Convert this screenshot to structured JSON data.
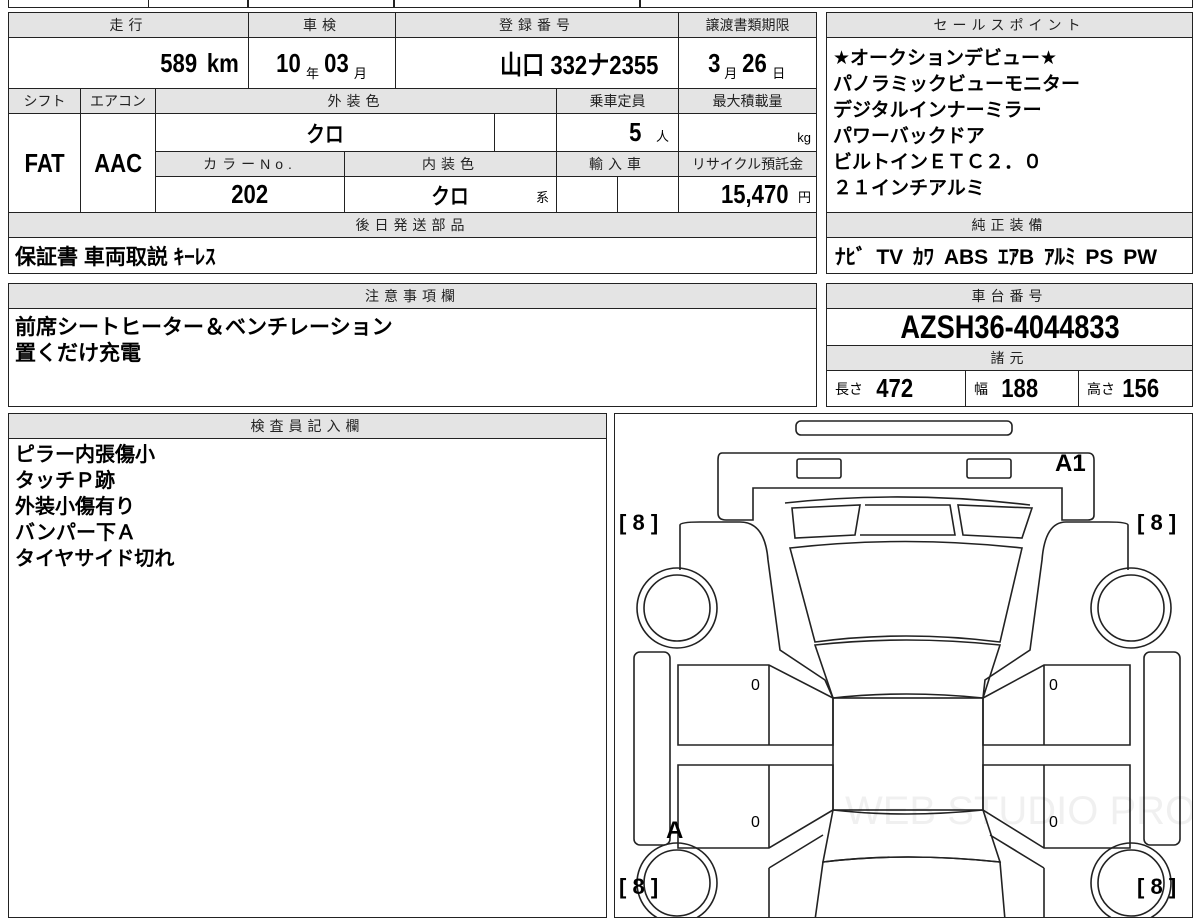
{
  "main": {
    "mileage": {
      "label": "走行",
      "value": "589",
      "unit": "km"
    },
    "inspection": {
      "label": "車検",
      "year": "10",
      "year_unit": "年",
      "month": "03",
      "month_unit": "月"
    },
    "registration": {
      "label": "登録番号",
      "value": "山口 332ナ2355"
    },
    "transfer_deadline": {
      "label": "譲渡書類期限",
      "month": "3",
      "month_unit": "月",
      "day": "26",
      "day_unit": "日"
    },
    "shift": {
      "label": "シフト",
      "value": "FAT"
    },
    "aircon": {
      "label": "エアコン",
      "value": "AAC"
    },
    "exterior_color": {
      "label": "外装色",
      "value": "クロ"
    },
    "capacity": {
      "label": "乗車定員",
      "value": "5",
      "unit": "人"
    },
    "max_load": {
      "label": "最大積載量",
      "unit": "kg"
    },
    "color_no": {
      "label": "カラーNo.",
      "value": "202"
    },
    "interior_color": {
      "label": "内装色",
      "value": "クロ",
      "suffix": "系"
    },
    "import": {
      "label": "輸入車"
    },
    "recycle": {
      "label": "リサイクル預託金",
      "value": "15,470",
      "unit": "円"
    },
    "later_parts": {
      "label": "後日発送部品",
      "value": "保証書 車両取説 ｷｰﾚｽ"
    }
  },
  "sales_points": {
    "label": "セールスポイント",
    "items": [
      "★オークションデビュー★",
      "パノラミックビューモニター",
      "デジタルインナーミラー",
      "パワーバックドア",
      "ビルトインＥＴＣ２．０",
      "２１インチアルミ"
    ]
  },
  "equipment": {
    "label": "純正装備",
    "value": "ﾅﾋﾞ TV ｶﾜ ABS ｴｱB ｱﾙﾐ PS PW"
  },
  "notes": {
    "label": "注意事項欄",
    "lines": [
      "前席シートヒーター＆ベンチレーション",
      "置くだけ充電"
    ]
  },
  "chassis": {
    "label": "車台番号",
    "value": "AZSH36-4044833"
  },
  "specs": {
    "label": "諸元",
    "length_label": "長さ",
    "length": "472",
    "width_label": "幅",
    "width": "188",
    "height_label": "高さ",
    "height": "156"
  },
  "inspector": {
    "label": "検査員記入欄",
    "lines": [
      "ピラー内張傷小",
      "タッチＰ跡",
      "外装小傷有り",
      "バンパー下Ａ",
      "タイヤサイド切れ"
    ]
  },
  "diagram": {
    "marks": {
      "front": "A1",
      "left_rear_wheel": "A",
      "door_lf": "0",
      "door_lr": "0",
      "door_rf": "0",
      "door_rr": "0"
    },
    "tread": [
      "8",
      "8",
      "8",
      "8"
    ],
    "watermark": "WEB STUDIO PRO"
  }
}
